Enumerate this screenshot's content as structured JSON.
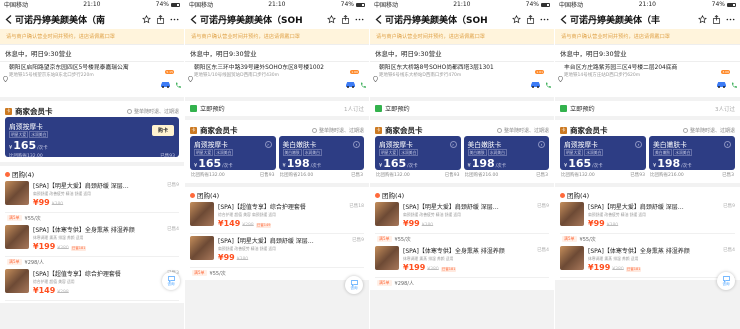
{
  "status": {
    "carrier": "中国移动",
    "time": "21:10",
    "battery": "74%"
  },
  "panels": [
    {
      "title": "可诺丹婷美颜美体（南",
      "notice": "请与商户确认营业时间并预约，进店请佩戴口罩",
      "hours": "休息中，明日9:30营业",
      "address": "朝阳区启阳路望京东园四区5号楼昆泰嘉瑞公寓",
      "address_sub": "距地铁15号线望京东站B东北口步行220m",
      "car_badge": "5·15",
      "card_section": {
        "title": "商家会员卡",
        "right": "整单随时退、过期退"
      },
      "cards": [
        {
          "name": "肩颈按摩卡",
          "tags": [
            "明星大爱",
            "水润美白"
          ],
          "price": "165",
          "unit": "/次卡",
          "compare": "比团购省132.00",
          "sold": "已售93",
          "buy": "购卡"
        }
      ],
      "group": {
        "title": "团购(4)"
      },
      "deals": [
        {
          "name": "[SPA]【明星大爱】肩颈舒缓 深层…",
          "tags": "肩颈舒缓 改善疲劳 精油 舒缓 适用",
          "price": "99",
          "orig": "¥380",
          "sold": "已售9",
          "sub_chip": "满5单",
          "sub_text": "¥55/次",
          "has_sub": true
        },
        {
          "name": "[SPA]【体寒专供】全身熏蒸 排湿养颜",
          "tags": "体寒调理 熏蒸 排湿 养颜 适用",
          "price": "199",
          "orig": "¥380",
          "sold": "已售4",
          "badge": "已省181",
          "sub_chip": "满5单",
          "sub_text": "¥298/人",
          "has_sub": true
        },
        {
          "name": "[SPA]【超值专享】综合护理套餐",
          "tags": "综合护理 超值 美容 适用",
          "price": "149",
          "orig": "¥298",
          "sold": "已售3",
          "has_sub": false
        }
      ],
      "consult": "咨询"
    },
    {
      "title": "可诺丹婷美颜美体（SOH",
      "notice": "请与商户确认营业时间并预约，进店请佩戴口罩",
      "hours": "休息中，明日9:30营业",
      "address": "朝阳区东三环中路39号建外SOHO东区8号楼1002",
      "address_sub": "距地铁1/10号线国贸站D西南口步行430m",
      "car_badge": "1·66",
      "book": {
        "label": "立即预约",
        "more": "1人订过"
      },
      "card_section": {
        "title": "商家会员卡",
        "right": "整单随时退、过期退"
      },
      "cards": [
        {
          "name": "肩颈按摩卡",
          "tags": [
            "明星大爱",
            "水润美白"
          ],
          "price": "165",
          "unit": "/次卡",
          "compare": "比团购省132.00",
          "sold": "已售93"
        },
        {
          "name": "美白嫩肤卡",
          "tags": [
            "美白嫩肤",
            "水润美白"
          ],
          "price": "198",
          "unit": "/次卡",
          "compare": "比团购省216.00",
          "sold": "已售3"
        }
      ],
      "group": {
        "title": "团购(4)"
      },
      "deals": [
        {
          "name": "[SPA]【超值专享】综合护理套餐",
          "tags": "综合护理 超值 美容 肩颈舒缓 适用",
          "price": "149",
          "orig": "¥298",
          "sold": "已售18",
          "badge": "已省149",
          "has_sub": false
        },
        {
          "name": "[SPA]【明星大爱】肩颈舒缓 深层…",
          "tags": "肩颈舒缓 改善疲劳 精油 舒缓 适用",
          "price": "99",
          "orig": "¥380",
          "sold": "已售9",
          "sub_chip": "满5单",
          "sub_text": "¥55/次",
          "has_sub": true
        }
      ],
      "consult": "咨询"
    },
    {
      "title": "可诺丹婷美颜美体（SOH",
      "notice": "请与商户确认营业时间并预约，进店请佩戴口罩",
      "hours": "休息中，明日9:30营业",
      "address": "朝阳区东大桥路8号SOHO尚都西塔3层1301",
      "address_sub": "距地铁6号线东大桥站D西南口步行470m",
      "car_badge": "1·61",
      "book": {
        "label": "立即预约",
        "more": ""
      },
      "card_section": {
        "title": "商家会员卡",
        "right": "整单随时退、过期退"
      },
      "cards": [
        {
          "name": "肩颈按摩卡",
          "tags": [
            "明星大爱",
            "水润美白"
          ],
          "price": "165",
          "unit": "/次卡",
          "compare": "比团购省132.00",
          "sold": "已售93"
        },
        {
          "name": "美白嫩肤卡",
          "tags": [
            "美白嫩肤",
            "水润美白"
          ],
          "price": "198",
          "unit": "/次卡",
          "compare": "比团购省216.00",
          "sold": "已售3"
        }
      ],
      "group": {
        "title": "团购(4)"
      },
      "deals": [
        {
          "name": "[SPA]【明星大爱】肩颈舒缓 深层…",
          "tags": "肩颈舒缓 改善疲劳 精油 舒缓 适用",
          "price": "99",
          "orig": "¥380",
          "sold": "已售9",
          "sub_chip": "满5单",
          "sub_text": "¥55/次",
          "has_sub": true
        },
        {
          "name": "[SPA]【体寒专供】全身熏蒸 排湿养颜",
          "tags": "体寒调理 熏蒸 排湿 养颜 适用",
          "price": "199",
          "orig": "¥380",
          "sold": "已售4",
          "badge": "已省181",
          "sub_chip": "满5单",
          "sub_text": "¥298/人",
          "has_sub": true
        }
      ],
      "consult": "咨询"
    },
    {
      "title": "可诺丹婷美颜美体（丰",
      "notice": "请与商户确认营业时间并预约，进店请佩戴口罩",
      "hours": "休息中，明日9:30营业",
      "address": "丰台区方庄路紫芳园三区4号楼二层204底商",
      "address_sub": "距地铁14号线方庄站D西口步行620m",
      "car_badge": "3·06",
      "book": {
        "label": "立即预约",
        "more": "3人订过"
      },
      "card_section": {
        "title": "商家会员卡",
        "right": "整单随时退、过期退"
      },
      "cards": [
        {
          "name": "肩颈按摩卡",
          "tags": [
            "明星大爱",
            "水润美白"
          ],
          "price": "165",
          "unit": "/次卡",
          "compare": "比团购省132.00",
          "sold": "已售93"
        },
        {
          "name": "美白嫩肤卡",
          "tags": [
            "美白嫩肤",
            "水润美白"
          ],
          "price": "198",
          "unit": "/次卡",
          "compare": "比团购省216.00",
          "sold": "已售3"
        }
      ],
      "group": {
        "title": "团购(4)"
      },
      "deals": [
        {
          "name": "[SPA]【明星大爱】肩颈舒缓 深层…",
          "tags": "肩颈舒缓 改善疲劳 精油 舒缓 适用",
          "price": "99",
          "orig": "¥380",
          "sold": "已售9",
          "sub_chip": "满5单",
          "sub_text": "¥55/次",
          "has_sub": true
        },
        {
          "name": "[SPA]【体寒专供】全身熏蒸 排湿养颜",
          "tags": "体寒调理 熏蒸 排湿 养颜 适用",
          "price": "199",
          "orig": "¥380",
          "sold": "已售4",
          "badge": "已省181",
          "has_sub": false
        }
      ],
      "consult": "咨询"
    }
  ]
}
